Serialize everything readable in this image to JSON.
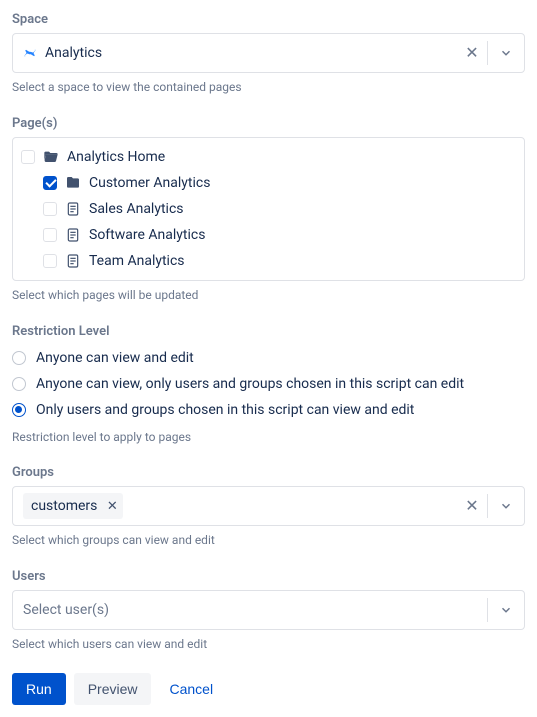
{
  "space": {
    "label": "Space",
    "value": "Analytics",
    "helper": "Select a space to view the contained pages"
  },
  "pages": {
    "label": "Page(s)",
    "helper": "Select which pages will be updated",
    "root": {
      "label": "Analytics Home",
      "checked": false
    },
    "children": [
      {
        "label": "Customer Analytics",
        "checked": true,
        "icon": "folder"
      },
      {
        "label": "Sales Analytics",
        "checked": false,
        "icon": "page"
      },
      {
        "label": "Software Analytics",
        "checked": false,
        "icon": "page"
      },
      {
        "label": "Team Analytics",
        "checked": false,
        "icon": "page"
      }
    ]
  },
  "restriction": {
    "label": "Restriction Level",
    "helper": "Restriction level to apply to pages",
    "options": [
      "Anyone can view and edit",
      "Anyone can view, only users and groups chosen in this script can edit",
      "Only users and groups chosen in this script can view and edit"
    ],
    "selected": 2
  },
  "groups": {
    "label": "Groups",
    "helper": "Select which groups can view and edit",
    "tags": [
      "customers"
    ]
  },
  "users": {
    "label": "Users",
    "helper": "Select which users can view and edit",
    "placeholder": "Select user(s)"
  },
  "buttons": {
    "run": "Run",
    "preview": "Preview",
    "cancel": "Cancel"
  }
}
